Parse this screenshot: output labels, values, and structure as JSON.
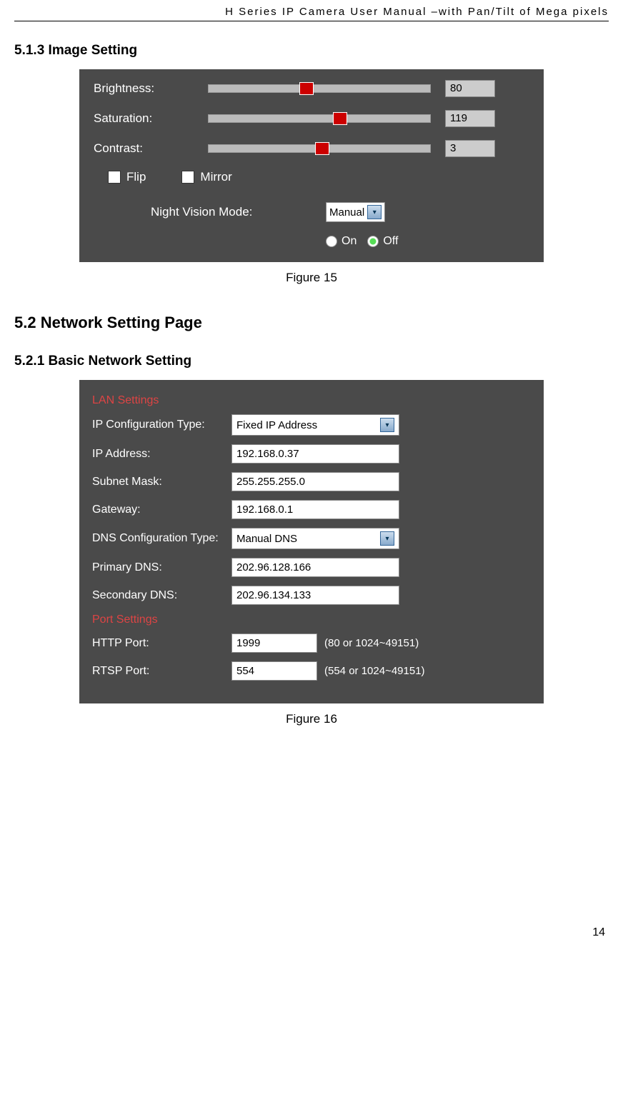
{
  "header": "H Series IP Camera User Manual –with Pan/Tilt of Mega pixels",
  "section_513": "5.1.3  Image Setting",
  "section_52": "5.2  Network Setting Page",
  "section_521": "5.2.1  Basic Network Setting",
  "fig15_caption": "Figure 15",
  "fig16_caption": "Figure 16",
  "page_number": "14",
  "fig15": {
    "brightness_label": "Brightness:",
    "brightness_value": "80",
    "saturation_label": "Saturation:",
    "saturation_value": "119",
    "contrast_label": "Contrast:",
    "contrast_value": "3",
    "flip_label": "Flip",
    "mirror_label": "Mirror",
    "nv_label": "Night Vision Mode:",
    "nv_value": "Manual",
    "on_label": "On",
    "off_label": "Off"
  },
  "fig16": {
    "lan_title": "LAN Settings",
    "ip_config_label": "IP Configuration Type:",
    "ip_config_value": "Fixed IP Address",
    "ip_addr_label": "IP Address:",
    "ip_addr_value": "192.168.0.37",
    "subnet_label": "Subnet Mask:",
    "subnet_value": "255.255.255.0",
    "gateway_label": "Gateway:",
    "gateway_value": "192.168.0.1",
    "dns_config_label": "DNS Configuration Type:",
    "dns_config_value": "Manual DNS",
    "primary_dns_label": "Primary DNS:",
    "primary_dns_value": "202.96.128.166",
    "secondary_dns_label": "Secondary DNS:",
    "secondary_dns_value": "202.96.134.133",
    "port_title": "Port Settings",
    "http_port_label": "HTTP Port:",
    "http_port_value": "1999",
    "http_port_hint": "(80 or 1024~49151)",
    "rtsp_port_label": "RTSP Port:",
    "rtsp_port_value": "554",
    "rtsp_port_hint": "(554 or 1024~49151)"
  }
}
